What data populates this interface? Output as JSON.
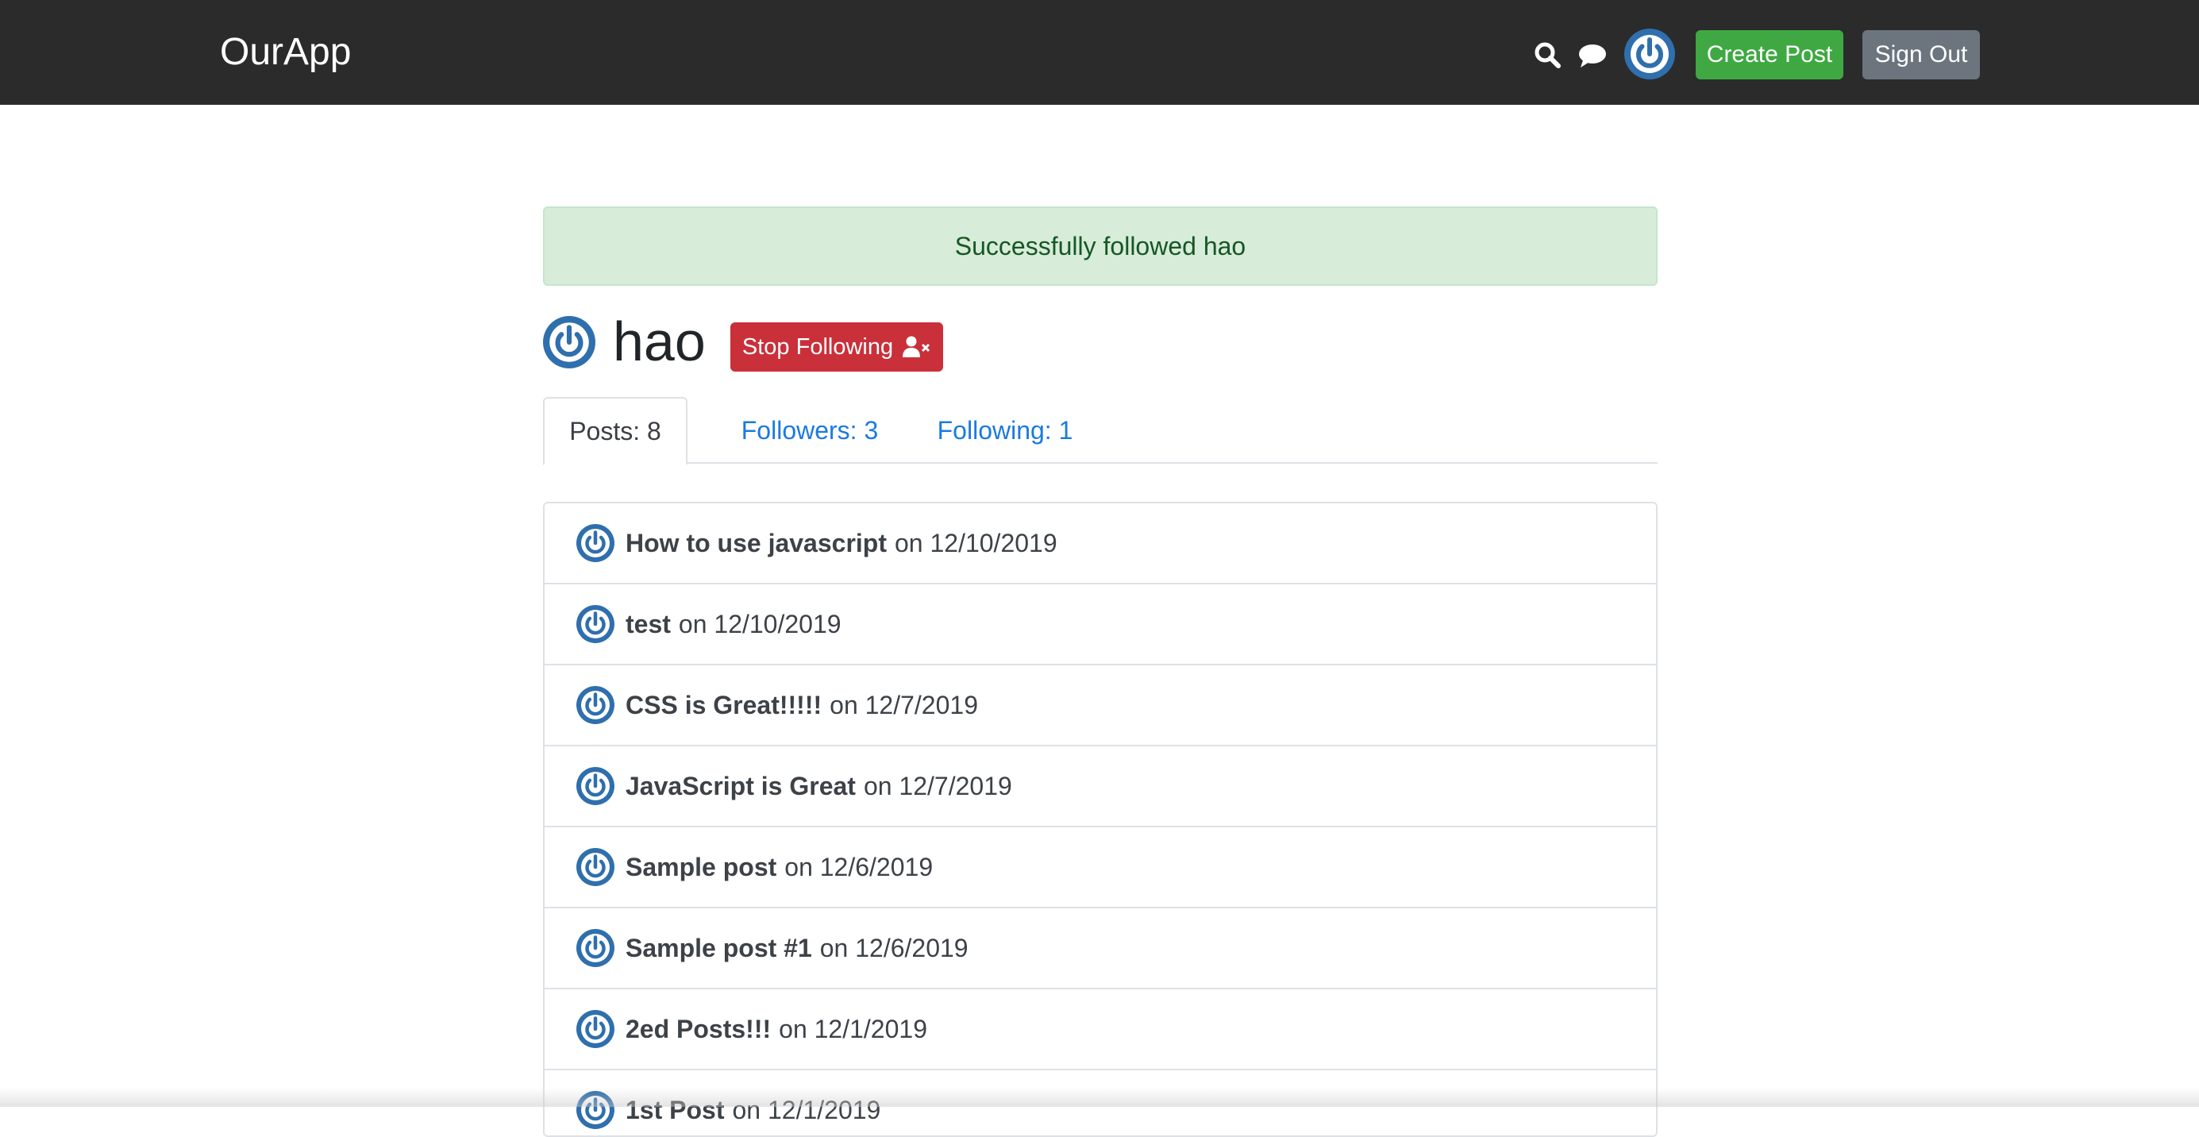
{
  "navbar": {
    "brand": "OurApp",
    "icons": [
      "search-icon",
      "chat-icon",
      "avatar"
    ],
    "create_post_label": "Create Post",
    "sign_out_label": "Sign Out"
  },
  "alert": {
    "message": "Successfully followed hao"
  },
  "profile": {
    "username": "hao",
    "stop_following_label": "Stop Following",
    "stop_following_icon": "user-times-icon"
  },
  "tabs": [
    {
      "label": "Posts: 8",
      "active": true
    },
    {
      "label": "Followers: 3",
      "active": false
    },
    {
      "label": "Following: 1",
      "active": false
    }
  ],
  "posts": [
    {
      "title": "How to use javascript",
      "date": "on 12/10/2019"
    },
    {
      "title": "test",
      "date": "on 12/10/2019"
    },
    {
      "title": "CSS is Great!!!!!",
      "date": "on 12/7/2019"
    },
    {
      "title": "JavaScript is Great",
      "date": "on 12/7/2019"
    },
    {
      "title": "Sample post",
      "date": "on 12/6/2019"
    },
    {
      "title": "Sample post #1",
      "date": "on 12/6/2019"
    },
    {
      "title": "2ed Posts!!!",
      "date": "on 12/1/2019"
    },
    {
      "title": "1st Post",
      "date": "on 12/1/2019"
    }
  ],
  "colors": {
    "navbar": "#2b2b2b",
    "create_post": "#3fa843",
    "sign_out": "#6c757d",
    "stop_following": "#c9303a",
    "link": "#1b7ae0",
    "avatar_blue": "#2f6fad"
  }
}
